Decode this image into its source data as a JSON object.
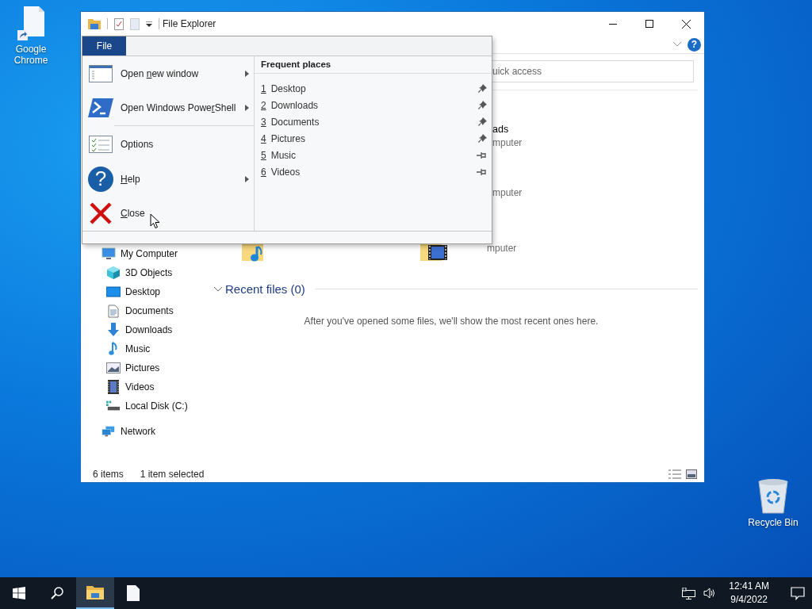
{
  "desktop_icons": [
    {
      "label": "Google Chrome",
      "kind": "shortcut"
    },
    {
      "label": "Recycle Bin",
      "kind": "bin"
    }
  ],
  "window": {
    "title": "File Explorer",
    "help_glyph": "?"
  },
  "file_menu": {
    "tab": "File",
    "items": [
      {
        "before": "Open ",
        "key": "n",
        "after": "ew window",
        "kind": "window",
        "submenu": true,
        "separator_after": false
      },
      {
        "before": "Open Windows Powe",
        "key": "r",
        "after": "Shell",
        "kind": "powershell",
        "submenu": true,
        "separator_after": true
      },
      {
        "before": "Options",
        "kind": "options",
        "submenu": false,
        "separator_after": false
      },
      {
        "key": "H",
        "after": "elp",
        "kind": "help",
        "glyph": "?",
        "submenu": true,
        "separator_after": false
      },
      {
        "key": "C",
        "after": "lose",
        "kind": "close",
        "submenu": false,
        "separator_after": false
      }
    ],
    "places_title": "Frequent places",
    "places": [
      {
        "number": "1",
        "label": "Desktop",
        "pinned": true
      },
      {
        "number": "2",
        "label": "Downloads",
        "pinned": true
      },
      {
        "number": "3",
        "label": "Documents",
        "pinned": true
      },
      {
        "number": "4",
        "label": "Pictures",
        "pinned": true
      },
      {
        "number": "5",
        "label": "Music",
        "pinned": false
      },
      {
        "number": "6",
        "label": "Videos",
        "pinned": false
      }
    ]
  },
  "quick_access": {
    "search_placeholder": "uick access",
    "folders": [
      {
        "name": "ads",
        "location": "mputer"
      },
      {
        "location": "mputer"
      },
      {
        "kind": "music"
      },
      {
        "kind": "videos",
        "location": "mputer"
      }
    ]
  },
  "navigation": [
    {
      "label": "My Computer",
      "kind": "computer",
      "children": [
        {
          "label": "3D Objects",
          "kind": "cube"
        },
        {
          "label": "Desktop",
          "kind": "desktop"
        },
        {
          "label": "Documents",
          "kind": "documents"
        },
        {
          "label": "Downloads",
          "kind": "downloads"
        },
        {
          "label": "Music",
          "kind": "music"
        },
        {
          "label": "Pictures",
          "kind": "pictures"
        },
        {
          "label": "Videos",
          "kind": "videos"
        },
        {
          "label": "Local Disk (C:)",
          "kind": "disk"
        }
      ]
    },
    {
      "label": "Network",
      "kind": "network"
    }
  ],
  "recent": {
    "title": "Recent files (0)",
    "expanded": true,
    "message": "After you've opened some files, we'll show the most recent ones here."
  },
  "status_bar": [
    "6 items",
    "1 item selected"
  ],
  "taskbar": {
    "apps": [
      {
        "kind": "explorer",
        "active": true
      },
      {
        "kind": "file",
        "active": false
      }
    ],
    "time": "12:41 AM",
    "date": "9/4/2022"
  }
}
